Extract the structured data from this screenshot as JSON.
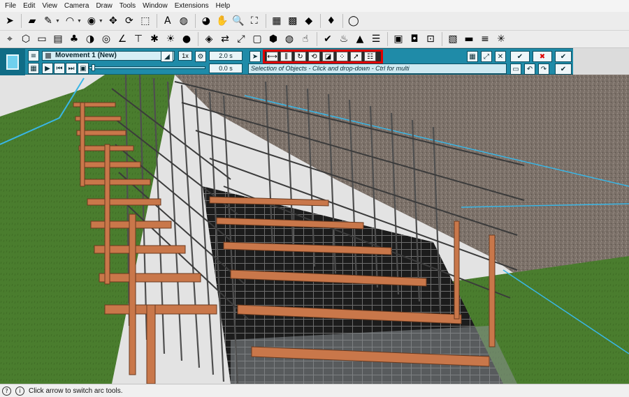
{
  "menu": [
    "File",
    "Edit",
    "View",
    "Camera",
    "Draw",
    "Tools",
    "Window",
    "Extensions",
    "Help"
  ],
  "toolbar_top": [
    {
      "icon": "select-arrow-icon",
      "glyph": "➤"
    },
    {
      "icon": "eraser-icon",
      "glyph": "▰"
    },
    {
      "icon": "pencil-icon",
      "glyph": "✎"
    },
    {
      "icon": "arc-icon",
      "glyph": "◠"
    },
    {
      "icon": "push-pull-icon",
      "glyph": "◉"
    },
    {
      "icon": "move-icon",
      "glyph": "✥"
    },
    {
      "icon": "rotate-icon",
      "glyph": "⟳"
    },
    {
      "icon": "scale-icon",
      "glyph": "⬚"
    },
    {
      "icon": "text-icon",
      "glyph": "A"
    },
    {
      "icon": "paint-bucket-icon",
      "glyph": "◍"
    },
    {
      "icon": "orbit-icon",
      "glyph": "◕"
    },
    {
      "icon": "pan-hand-icon",
      "glyph": "✋"
    },
    {
      "icon": "zoom-icon",
      "glyph": "🔍"
    },
    {
      "icon": "zoom-extents-icon",
      "glyph": "⛶"
    },
    {
      "icon": "warehouse-icon",
      "glyph": "▦"
    },
    {
      "icon": "components-icon",
      "glyph": "▩"
    },
    {
      "icon": "extension-warehouse-icon",
      "glyph": "◆"
    },
    {
      "icon": "ruby-icon",
      "glyph": "♦"
    },
    {
      "icon": "account-icon",
      "glyph": "◯"
    }
  ],
  "toolbar_second": [
    {
      "icon": "dimension-icon",
      "glyph": "⌖"
    },
    {
      "icon": "iso-view-icon",
      "glyph": "⬡"
    },
    {
      "icon": "top-view-icon",
      "glyph": "▭"
    },
    {
      "icon": "section-plane-icon",
      "glyph": "▤"
    },
    {
      "icon": "trees-icon",
      "glyph": "♣"
    },
    {
      "icon": "protractor-icon",
      "glyph": "◑"
    },
    {
      "icon": "circle-icon",
      "glyph": "◎"
    },
    {
      "icon": "angle-icon",
      "glyph": "∠"
    },
    {
      "icon": "table-icon",
      "glyph": "⊤"
    },
    {
      "icon": "star-icon",
      "glyph": "✱"
    },
    {
      "icon": "sun-icon",
      "glyph": "☀"
    },
    {
      "icon": "ball-icon",
      "glyph": "●"
    },
    {
      "icon": "solid-tools-icon",
      "glyph": "◈"
    },
    {
      "icon": "move-copy-icon",
      "glyph": "⇄"
    },
    {
      "icon": "scale-tool-icon",
      "glyph": "⤢"
    },
    {
      "icon": "box-icon",
      "glyph": "▢"
    },
    {
      "icon": "cube-icon",
      "glyph": "⬢"
    },
    {
      "icon": "sphere-icon",
      "glyph": "◍"
    },
    {
      "icon": "hand-icon",
      "glyph": "☝"
    },
    {
      "icon": "check-icon",
      "glyph": "✔"
    },
    {
      "icon": "teapot-icon",
      "glyph": "♨"
    },
    {
      "icon": "sandbox-icon",
      "glyph": "▲"
    },
    {
      "icon": "layers-icon",
      "glyph": "☰"
    },
    {
      "icon": "window-icon",
      "glyph": "▣"
    },
    {
      "icon": "camera-icon",
      "glyph": "◘"
    },
    {
      "icon": "lock-icon",
      "glyph": "⊡"
    },
    {
      "icon": "clapboard-icon",
      "glyph": "▧"
    },
    {
      "icon": "monitor-icon",
      "glyph": "▬"
    },
    {
      "icon": "sliders-icon",
      "glyph": "≡"
    },
    {
      "icon": "network-icon",
      "glyph": "✳"
    }
  ],
  "animation": {
    "movement_name": "Movement 1 (New)",
    "speed": "1x",
    "duration_value": "2.0 s",
    "time_value": "0.0 s",
    "hint_text": "Selection of Objects - Click and drop-down - Ctrl for multi",
    "movement_types": [
      {
        "icon": "translate-icon",
        "glyph": "⟷"
      },
      {
        "icon": "explode-icon",
        "glyph": "⫼"
      },
      {
        "icon": "rotate-movement-icon",
        "glyph": "↻"
      },
      {
        "icon": "rotate-axis-icon",
        "glyph": "⟲"
      },
      {
        "icon": "scale-movement-icon",
        "glyph": "◪"
      },
      {
        "icon": "scatter-icon",
        "glyph": "⁘"
      },
      {
        "icon": "path-icon",
        "glyph": "➚"
      },
      {
        "icon": "list-icon",
        "glyph": "☷"
      }
    ]
  },
  "status": {
    "text": "Click arrow to switch arc tools."
  },
  "colors": {
    "panel_accent": "#1f8ba8",
    "highlight_box": "#e00000",
    "grass": "#4a7d2e",
    "gravel": "#7b7068",
    "timber": "#c9774a"
  }
}
